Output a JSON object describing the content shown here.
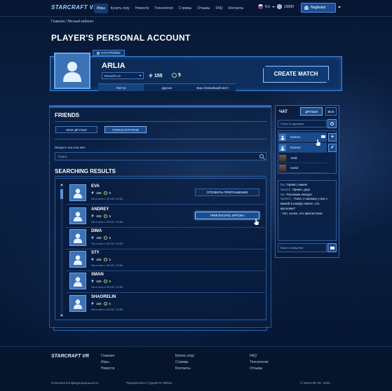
{
  "nav": {
    "logo": "STARCRAFT VR",
    "items": [
      "Игры",
      "Купить игру",
      "Новости",
      "Технология",
      "Стримы",
      "Отзывы",
      "FAQ",
      "Контакты"
    ],
    "active_index": 0,
    "language": "RU",
    "balance": "10000",
    "username": "Nagibator"
  },
  "breadcrumb": "Главная / Личный кабинет",
  "page_title": "PLAYER'S PERSONAL ACCOUNT",
  "account": {
    "settings_label": "НАСТРОЙКИ",
    "name": "ARLIA",
    "role": "ROLEPLAY",
    "energy": "155",
    "rank": "5",
    "tabs": [
      "Матчи",
      "Друзья",
      "Ваш ближайший матч"
    ],
    "active_tab": 0,
    "create_button": "CREATE MATCH"
  },
  "friends": {
    "title": "FRIENDS",
    "tabs": [
      "МОИ ДРУЗЬЯ",
      "ПОИСК ИГРАКОВ"
    ],
    "active_tab": 1,
    "search_label": "Введите ник или имя",
    "search_placeholder": "Поиск",
    "results_title": "SEARCHING RESULTS",
    "players": [
      {
        "name": "EVA",
        "energy": "155",
        "rank": "5",
        "online": "Не в сети с 20.05 / 12:00",
        "action": "ОТОЗВАТЬ ПРИГЛАШЕНИЕ"
      },
      {
        "name": "ANDREY",
        "energy": "155",
        "rank": "5",
        "online": "Не в сети с 20.05 / 12:00",
        "action": "ПРИГЛАСИТЬ ИГРОКА"
      },
      {
        "name": "DIMA",
        "energy": "155",
        "rank": "5",
        "online": "Не в сети с 20.05 / 12:00",
        "action": ""
      },
      {
        "name": "STY",
        "energy": "155",
        "rank": "5",
        "online": "Не в сети с 20.05 / 12:00",
        "action": ""
      },
      {
        "name": "SMAN",
        "energy": "155",
        "rank": "5",
        "online": "Не в сети с 20.05 / 12:00",
        "action": ""
      },
      {
        "name": "SHAORELIN",
        "energy": "155",
        "rank": "5",
        "online": "Не в сети с 20.05 / 12:00",
        "action": ""
      }
    ]
  },
  "chat": {
    "title": "ЧАТ",
    "tabs": [
      "ДРУЗЬЯ",
      "ВСЕ"
    ],
    "active_tab": 0,
    "search_placeholder": "Поиск по друзьям",
    "friends": [
      {
        "name": "Name1"
      },
      {
        "name": "Name2"
      },
      {
        "name": "Ataki"
      },
      {
        "name": "Ivand"
      }
    ],
    "messages": [
      {
        "who": "Вы:",
        "text": " Привет, ёжкин!"
      },
      {
        "who": "Name2:",
        "text": " Привет, дед!"
      },
      {
        "who": "Вы:",
        "text": " Расскажи анекдот"
      },
      {
        "who": "Name2:",
        "text": " - Папа, я какашку у вас с мамой в шкафу нашёл, это мультики?"
      },
      {
        "who": "",
        "text": "- Нет, сынок, это фантастика!"
      }
    ],
    "input_placeholder": "Ваше сообщение"
  },
  "footer": {
    "logo": "STARCRAFT VR",
    "col1": [
      "Главная",
      "Игры",
      "Новости"
    ],
    "col2": [
      "Купить игру",
      "Стримы",
      "Контакты"
    ],
    "col3": [
      "FAQ",
      "Технология",
      "Отзывы"
    ],
    "privacy": "Политика Конфиденциальности",
    "dev": "Разработано Студией ♥ AdRise",
    "copyright": "© StarCraft VR, 2020"
  }
}
